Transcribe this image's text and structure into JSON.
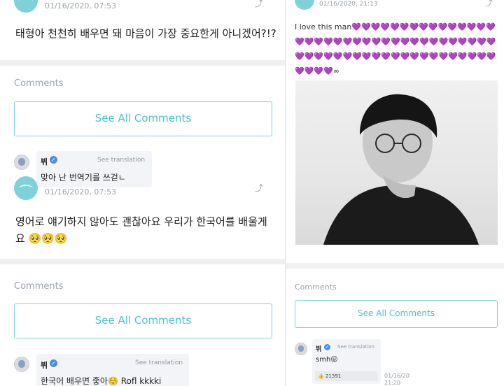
{
  "left": {
    "post1": {
      "date": "01/16/2020, 07:53",
      "text": "태형아 천천히 배우면 돼 마음이 가장 중요한게 아니겠어?!?"
    },
    "comments1": {
      "label": "Comments",
      "button": "See All Comments",
      "comment": {
        "user": "뷔",
        "see_translation": "See translation",
        "text": "맞아 난 번역기를 쓰걷ㄴ"
      }
    },
    "post2": {
      "date": "01/16/2020, 07:53",
      "text_line1": "영어로 얘기하지 않아도 괜찮아요 우리가 한국어를 배울게",
      "text_line2": "요 🥺🥺🥺"
    },
    "comments2": {
      "label": "Comments",
      "button": "See All Comments",
      "comment": {
        "user": "뷔",
        "see_translation": "See translation",
        "text": "한국어 배우면 좋아☺️ Rofl kkkki"
      }
    }
  },
  "right": {
    "post": {
      "date": "01/16/2020, 21:13",
      "text": "I love this man💜💜💜💜💜💜💜💜💜💜💜💜💜💜💜💜💜💜💜💜💜💜💜💜💜💜💜💜💜💜💜💜💜💜💜💜💜💜💜💜💜💜💜💜💜💜💜💜💜💜💜💜💜💜💜💜💜💜💜💜💜∞"
    },
    "comments": {
      "label": "Comments",
      "button": "See All Comments",
      "comment": {
        "user": "뷔",
        "see_translation": "See translation",
        "text": "smh😛",
        "likes": "21391",
        "date": "01/16/20",
        "time": "21:20"
      }
    }
  },
  "colors": {
    "accent": "#4fc0cb",
    "accent_border": "#7fd1d9",
    "verified": "#4a90e2",
    "muted": "#9aa3ab",
    "heart": "#9b59d0"
  },
  "icons": [
    "share-icon",
    "verified-icon",
    "thumbs-up-icon"
  ]
}
